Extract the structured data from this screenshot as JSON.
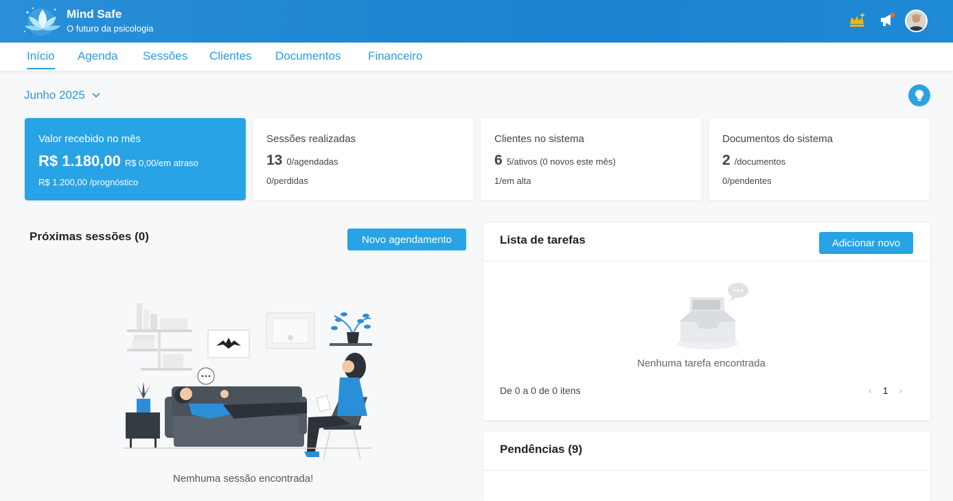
{
  "brand": {
    "name": "Mind Safe",
    "tagline": "O futuro da psicologia"
  },
  "header_icons": [
    "crown-icon",
    "megaphone-icon",
    "avatar"
  ],
  "colors": {
    "brand_gradient": "#1f85d3",
    "accent": "#28a3e5",
    "notification": "#ff6a2c",
    "crown": "#f5b400"
  },
  "nav": [
    "Início",
    "Agenda",
    "Sessões",
    "Clientes",
    "Documentos",
    "Financeiro"
  ],
  "period": {
    "label": "Junho 2025"
  },
  "cards": [
    {
      "title": "Valor recebido no mês",
      "big": "R$ 1.180,00",
      "side": "R$ 0,00/em atraso",
      "foot": "R$ 1.200,00 /prognóstico"
    },
    {
      "title": "Sessões realizadas",
      "big": "13",
      "side": "0/agendadas",
      "foot": "0/perdidas"
    },
    {
      "title": "Clientes no sistema",
      "big": "6",
      "side": "5/ativos (0 novos este mês)",
      "foot": "1/em alta"
    },
    {
      "title": "Documentos do sistema",
      "big": "2",
      "side": "/documentos",
      "foot": "0/pendentes"
    }
  ],
  "sessions": {
    "title": "Próximas sessões (0)",
    "button": "Novo agendamento",
    "empty": "Nemhuma sessão encontrada!"
  },
  "tasks": {
    "title": "Lista de tarefas",
    "button": "Adicionar novo",
    "empty": "Nenhuma tarefa encontrada",
    "range": "De 0 a 0 de 0 itens",
    "page": "1"
  },
  "pending": {
    "title": "Pendências (9)"
  }
}
